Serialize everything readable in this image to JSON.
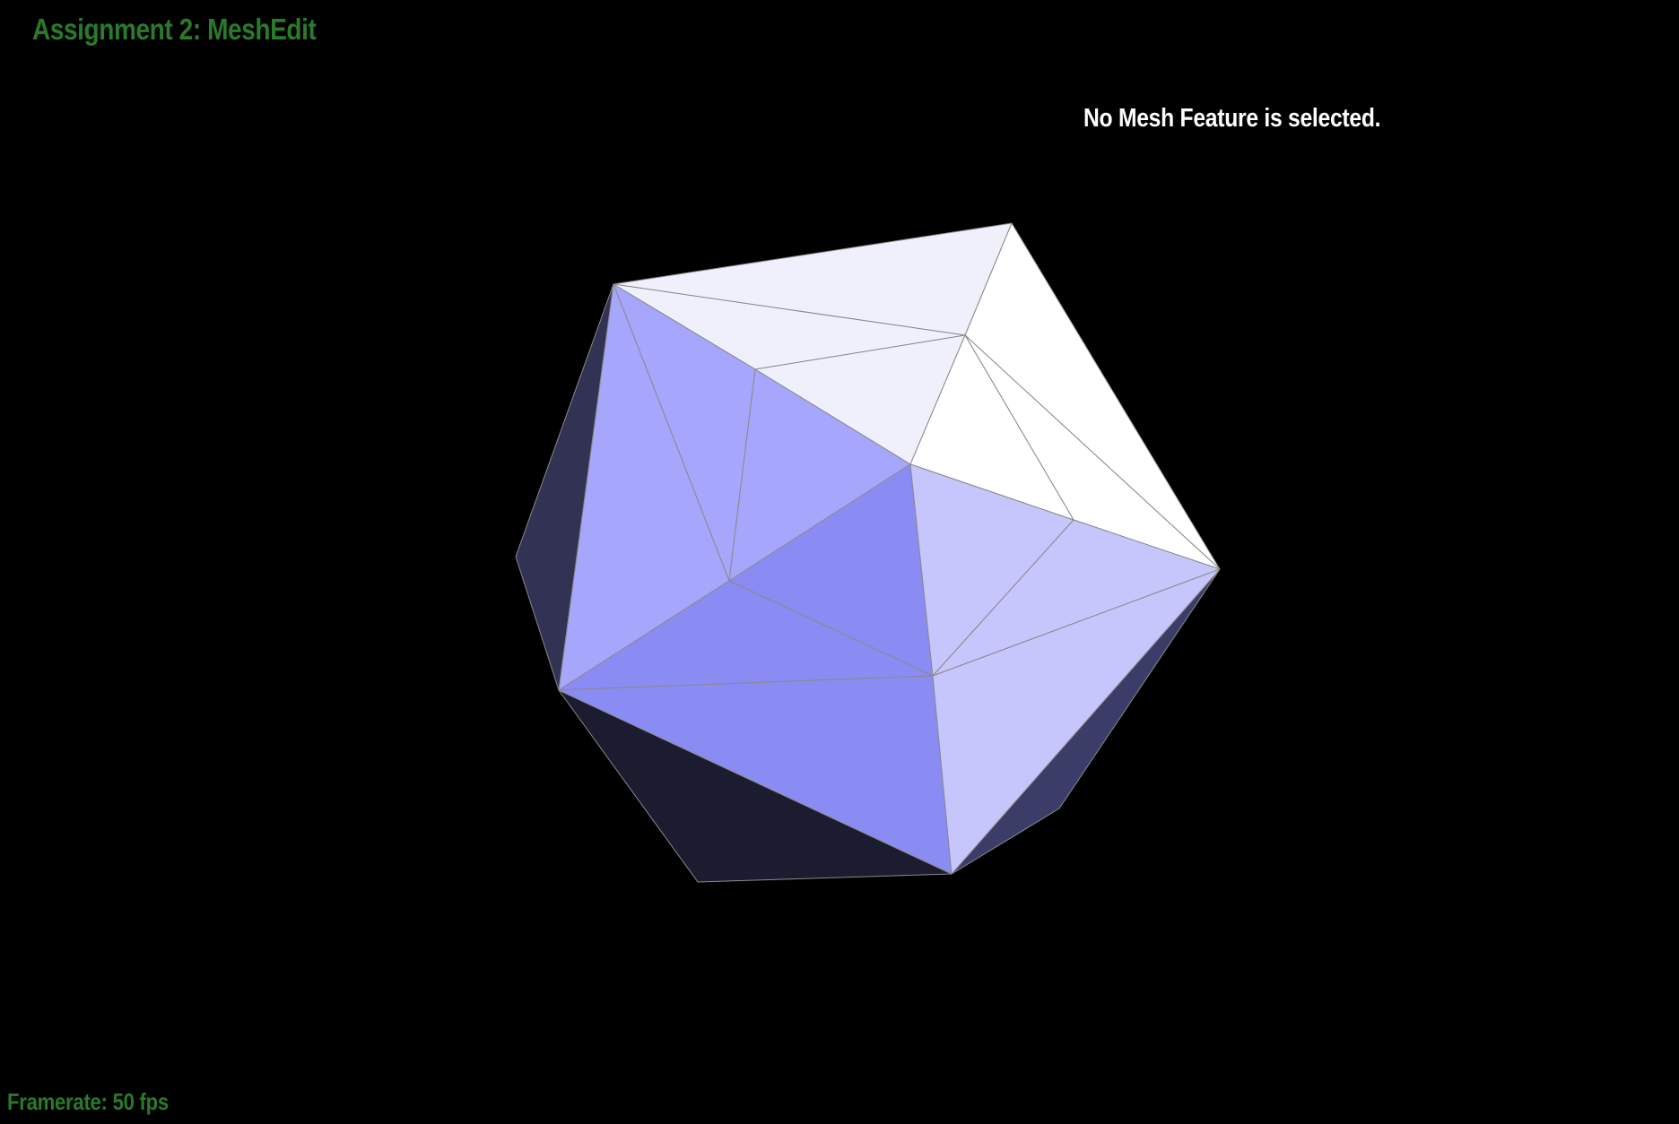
{
  "app": {
    "title": "Assignment 2: MeshEdit",
    "title_color": "#2a7a2a"
  },
  "status": {
    "selection_text": "No Mesh Feature is selected.",
    "selection_color": "#ffffff",
    "framerate_label": "Framerate: 50 fps",
    "framerate_color": "#2a7a2a"
  },
  "mesh": {
    "shape": "icosahedron",
    "edge_color": "#8a8a8a",
    "face_colors": {
      "top_light": "#f0f0fc",
      "white": "#ffffff",
      "lavender": "#a6a6fc",
      "blue": "#8b8bf4",
      "light_lavender": "#c6c6fc",
      "dark_side": "#323255",
      "darker_bottom": "#1c1c30",
      "dark_right": "#3c3c68"
    }
  },
  "background_color": "#000000"
}
